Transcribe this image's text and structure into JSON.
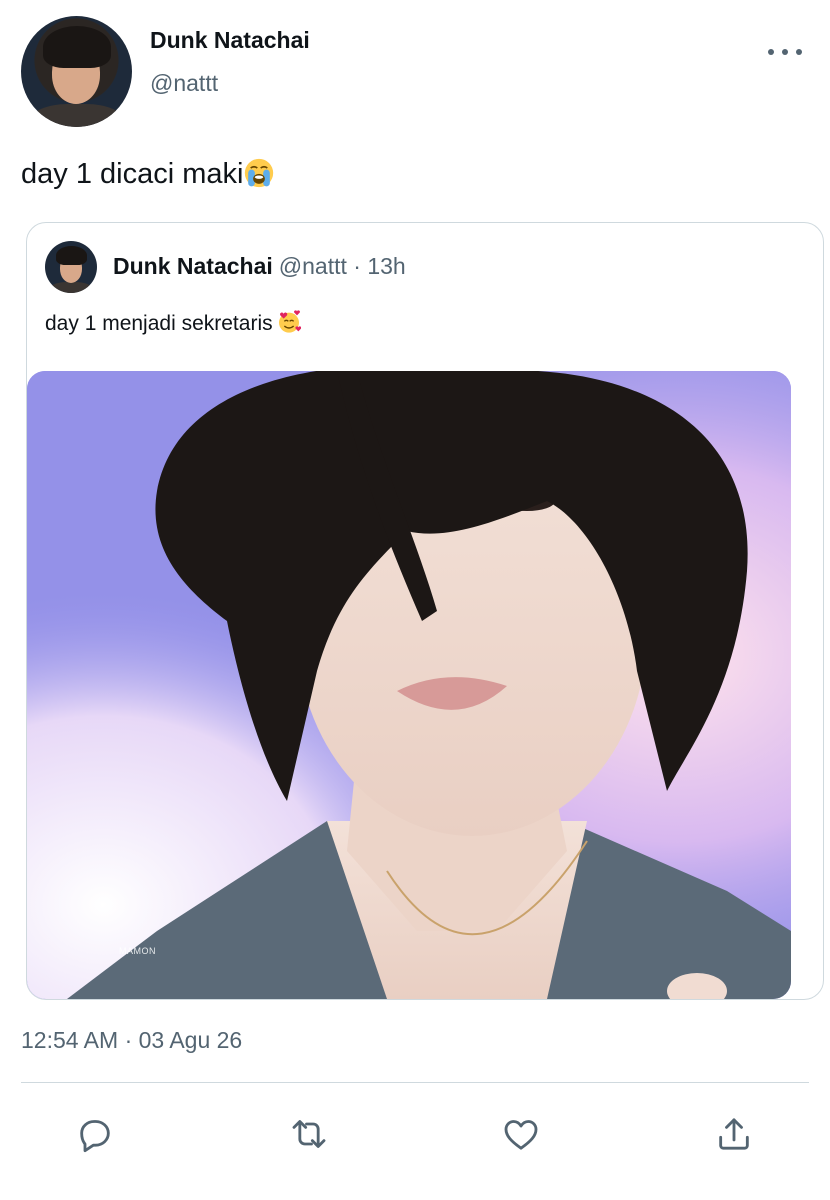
{
  "tweet": {
    "display_name": "Dunk Natachai",
    "handle": "@nattt",
    "text": "day 1 dicaci maki",
    "text_emoji": "loudly-crying-face-emoji",
    "timestamp": "12:54 AM · 03 Agu 26"
  },
  "quoted_tweet": {
    "display_name": "Dunk Natachai",
    "handle": "@nattt",
    "separator": "·",
    "age": "13h",
    "text": "day 1 menjadi sekretaris",
    "text_emoji": "smiling-face-with-hearts-emoji",
    "photo": {
      "alt_subject": "portrait-photo",
      "watermark": "MAMON"
    }
  },
  "actions": {
    "reply_icon": "reply-icon",
    "retweet_icon": "retweet-icon",
    "like_icon": "heart-icon",
    "share_icon": "share-icon"
  },
  "colors": {
    "primary_text": "#0f1419",
    "secondary_text": "#536471",
    "border": "#cfd9de"
  }
}
